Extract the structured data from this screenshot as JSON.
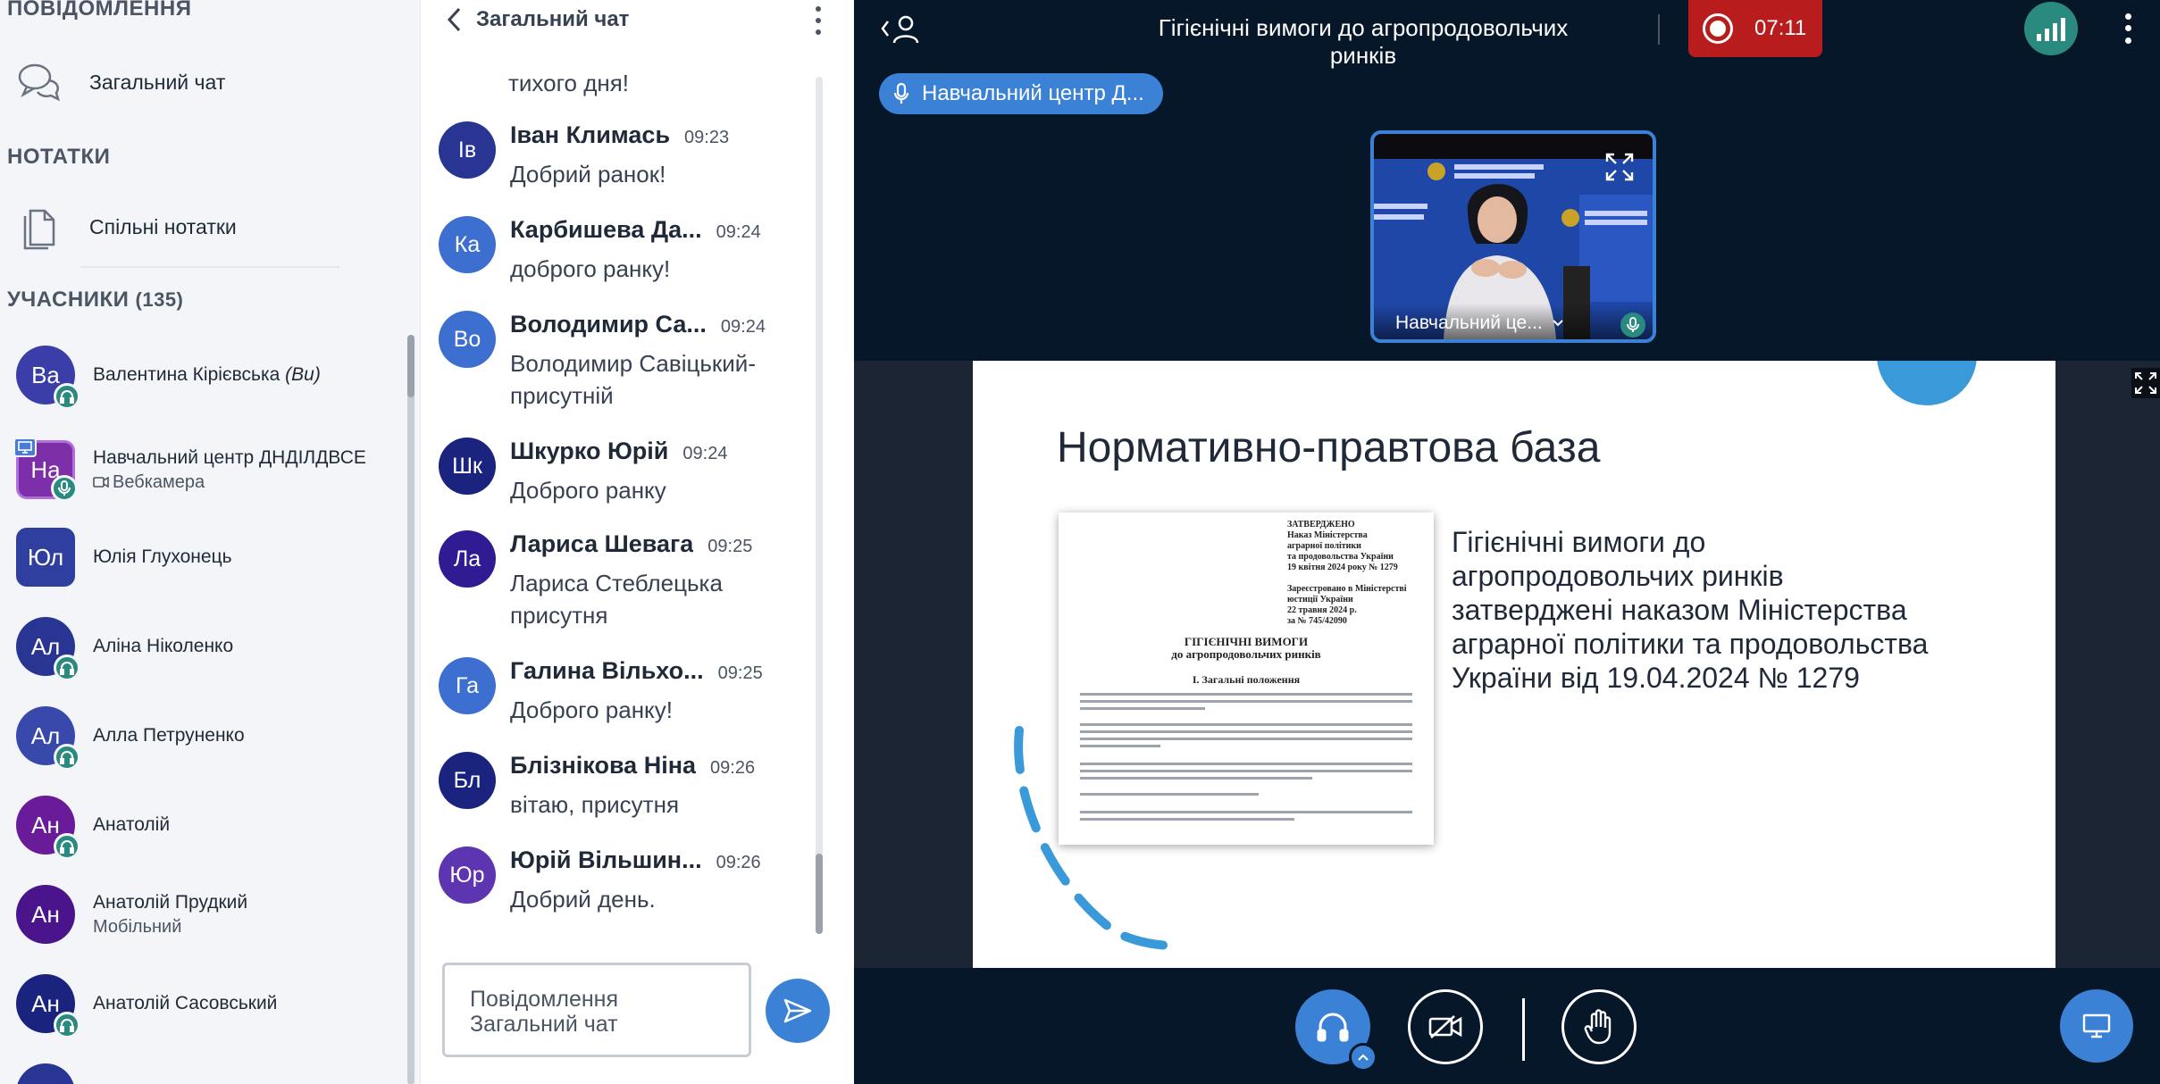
{
  "sidebar": {
    "messages_title": "ПОВІДОМЛЕННЯ",
    "public_chat_label": "Загальний чат",
    "notes_title": "НОТАТКИ",
    "shared_notes_label": "Спільні нотатки",
    "users_title": "УЧАСНИКИ",
    "users_count": "(135)",
    "users": [
      {
        "initials": "Ва",
        "name": "Валентина Кірієвська",
        "you": "(Ви)",
        "sub": "",
        "color": "#3b3da8"
      },
      {
        "initials": "На",
        "name": "Навчальний центр ДНДІЛДВСЕ",
        "you": "",
        "sub": "Вебкамера",
        "color": "#7c2fa8"
      },
      {
        "initials": "Юл",
        "name": "Юлія Глухонець",
        "you": "",
        "sub": "",
        "color": "#2f3fa0"
      },
      {
        "initials": "Ал",
        "name": "Аліна Ніколенко",
        "you": "",
        "sub": "",
        "color": "#283593"
      },
      {
        "initials": "Ал",
        "name": "Алла Петруненко",
        "you": "",
        "sub": "",
        "color": "#3949ab"
      },
      {
        "initials": "Ан",
        "name": "Анатолій",
        "you": "",
        "sub": "",
        "color": "#6a1b9a"
      },
      {
        "initials": "Ан",
        "name": "Анатолій Прудкий",
        "you": "",
        "sub": "Мобільний",
        "color": "#4a148c"
      },
      {
        "initials": "Ан",
        "name": "Анатолій Сасовський",
        "you": "",
        "sub": "",
        "color": "#1a237e"
      }
    ]
  },
  "chat": {
    "title": "Загальний чат",
    "cut_text": "тихого дня!",
    "messages": [
      {
        "initials": "Ів",
        "name": "Іван Климась",
        "time": "09:23",
        "text": "Добрий ранок!",
        "color": "#283593"
      },
      {
        "initials": "Ка",
        "name": "Карбишева Да...",
        "time": "09:24",
        "text": "доброго ранку!",
        "color": "#3d6fd1"
      },
      {
        "initials": "Во",
        "name": "Володимир Са...",
        "time": "09:24",
        "text": "Володимир Савіцький- присутній",
        "color": "#3d6fd1"
      },
      {
        "initials": "Шк",
        "name": "Шкурко Юрій",
        "time": "09:24",
        "text": "Доброго ранку",
        "color": "#1a237e"
      },
      {
        "initials": "Ла",
        "name": "Лариса Шевага",
        "time": "09:25",
        "text": "Лариса Стеблецька присутня",
        "color": "#311b92"
      },
      {
        "initials": "Га",
        "name": "Галина Вільхо...",
        "time": "09:25",
        "text": "Доброго ранку!",
        "color": "#3d6fd1"
      },
      {
        "initials": "Бл",
        "name": "Блізнікова Ніна",
        "time": "09:26",
        "text": "вітаю, присутня",
        "color": "#1a237e"
      },
      {
        "initials": "Юр",
        "name": "Юрій Вільшин...",
        "time": "09:26",
        "text": "Добрий день.",
        "color": "#5e35b1"
      }
    ],
    "input_placeholder": "Повідомлення Загальний чат"
  },
  "meeting": {
    "title": "Гігієнічні вимоги до агропродовольчих ринків",
    "rec_time": "07:11",
    "talking": "Навчальний центр Д...",
    "webcam_name": "Навчальний це..."
  },
  "slide": {
    "title": "Нормативно-правтова база",
    "text": "Гігієнічні вимоги до агропродовольчих ринків затверджені наказом Міністерства аграрної політики та продовольства України від 19.04.2024  № 1279",
    "doc": {
      "approved": [
        "ЗАТВЕРДЖЕНО",
        "Наказ Міністерства",
        "аграрної політики",
        "та продовольства України",
        "19 квітня 2024 року № 1279"
      ],
      "registered": [
        "Зареєстровано в Міністерстві",
        "юстиції України",
        "22 травня 2024 р.",
        "за № 745/42090"
      ],
      "heading": [
        "ГІГІЄНІЧНІ ВИМОГИ",
        "до агропродовольчих ринків"
      ],
      "section": "I. Загальні положення"
    }
  },
  "colors": {
    "accent": "#3b82d6",
    "recording": "#b91c1c",
    "talking_green": "#2b8a7f",
    "dark_bg": "#06172a"
  }
}
